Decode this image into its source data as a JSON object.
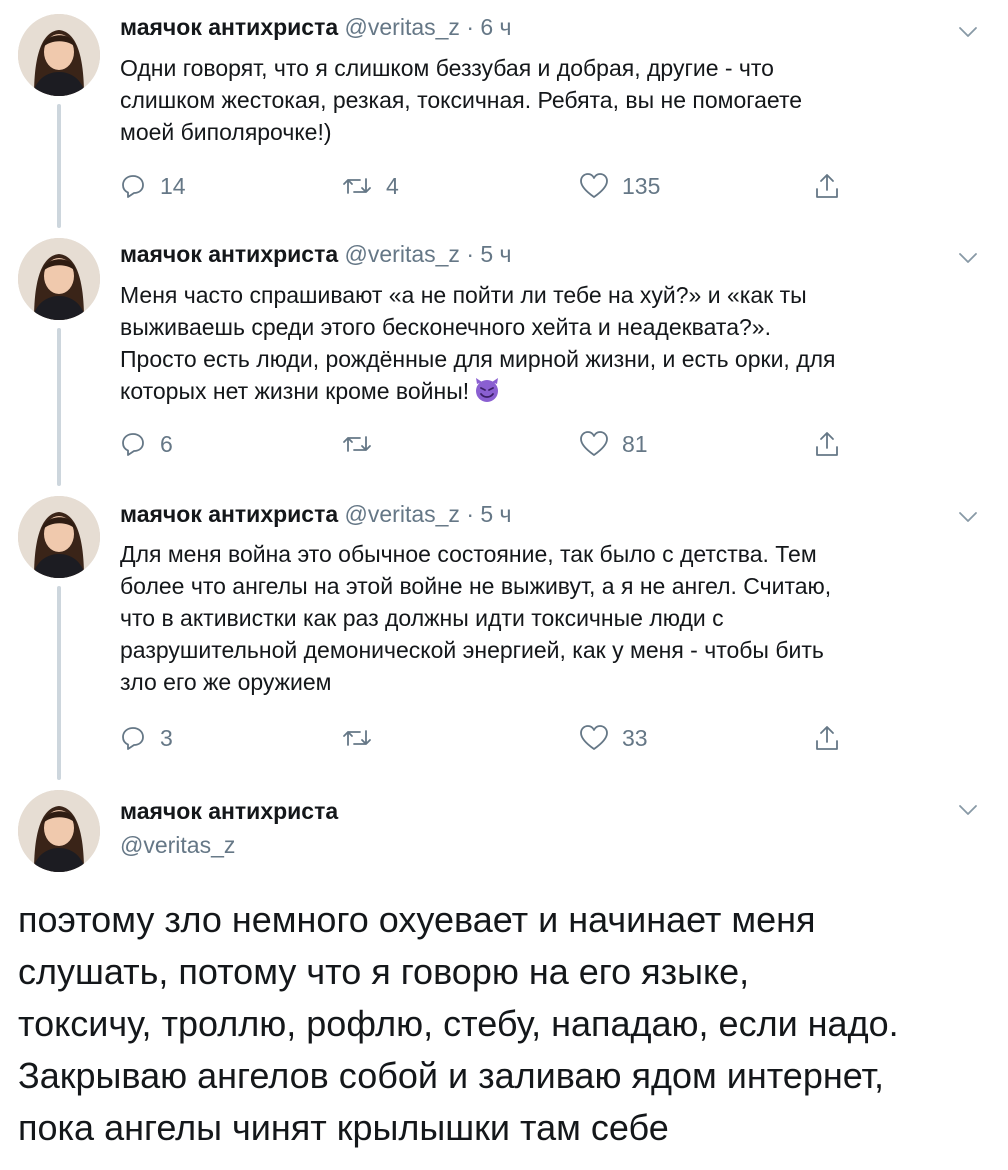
{
  "tweets": [
    {
      "name": "маячок антихриста",
      "handle": "@veritas_z",
      "dot": "·",
      "time": "6 ч",
      "text": "Одни говорят, что я слишком беззубая и добрая, другие - что\nслишком жестокая, резкая, токсичная. Ребята, вы не помогаете\nмоей биполярочке!)",
      "replies": "14",
      "retweets": "4",
      "likes": "135"
    },
    {
      "name": "маячок антихриста",
      "handle": "@veritas_z",
      "dot": "·",
      "time": "5 ч",
      "text": "Меня часто спрашивают «а не пойти ли тебе на хуй?» и «как ты\nвыживаешь среди этого бесконечного хейта и неадеквата?».\nПросто есть люди, рождённые для мирной жизни, и есть орки, для\nкоторых нет жизни кроме войны!",
      "emoji": "smiling-devil-emoji",
      "replies": "6",
      "retweets": "",
      "likes": "81"
    },
    {
      "name": "маячок антихриста",
      "handle": "@veritas_z",
      "dot": "·",
      "time": "5 ч",
      "text": "Для меня война это обычное состояние, так было с детства. Тем\nболее что ангелы на этой войне не выживут, а я не ангел. Считаю,\nчто в активистки как раз должны идти токсичные люди с\nразрушительной демонической энергией, как у меня - чтобы бить\nзло его же оружием",
      "replies": "3",
      "retweets": "",
      "likes": "33"
    }
  ],
  "main_tweet": {
    "name": "маячок антихриста",
    "handle": "@veritas_z",
    "text": "поэтому зло немного охуевает и начинает меня\nслушать, потому что я говорю на его языке,\nтоксичу, троллю, рофлю, стебу, нападаю, если надо.\nЗакрываю ангелов собой и заливаю ядом интернет,\nпока ангелы чинят крылышки там себе"
  },
  "icons": {
    "reply": "reply-icon",
    "retweet": "retweet-icon",
    "like": "heart-icon",
    "share": "share-icon",
    "menu": "chevron-down-icon"
  },
  "colors": {
    "text": "#14171a",
    "secondary": "#657786",
    "thread_line": "#cdd6dd",
    "emoji": "#8a5fd1"
  }
}
